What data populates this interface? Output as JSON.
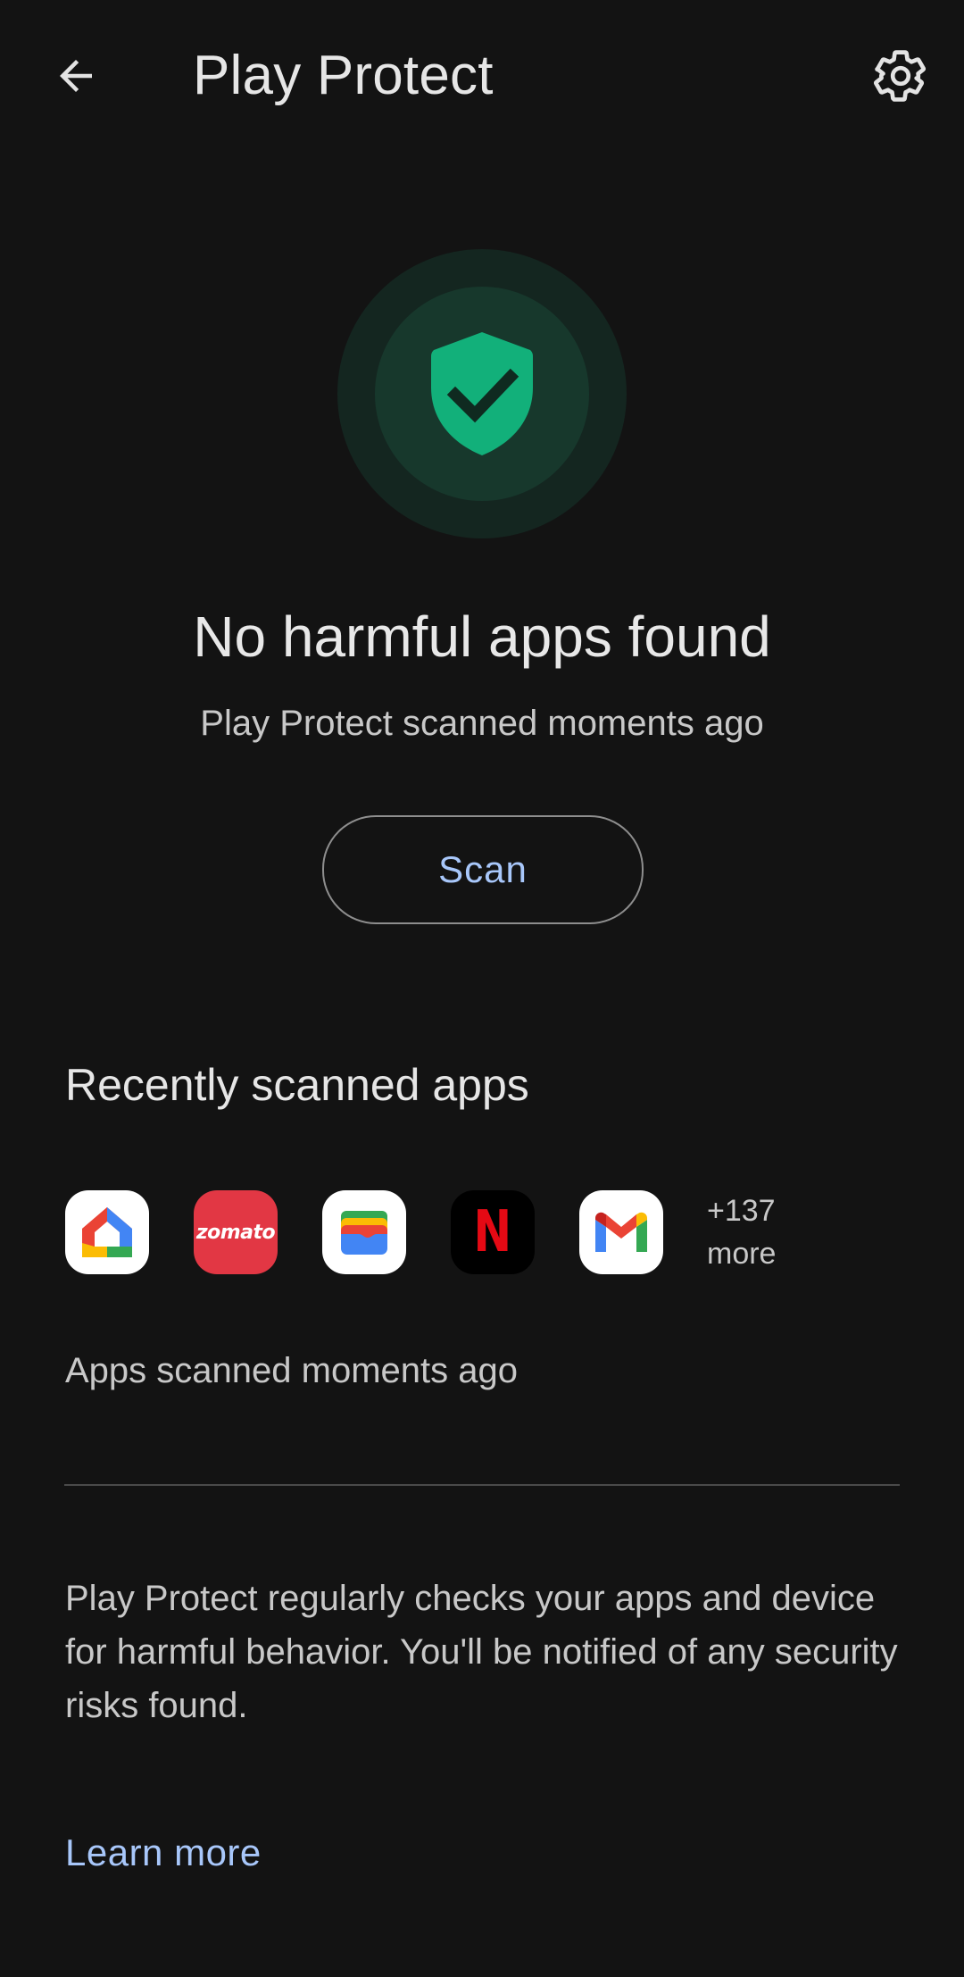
{
  "header": {
    "title": "Play Protect",
    "back_icon": "arrow-back-icon",
    "settings_icon": "gear-icon"
  },
  "status": {
    "icon": "shield-check-icon",
    "headline": "No harmful apps found",
    "subline": "Play Protect scanned moments ago",
    "scan_label": "Scan"
  },
  "recent": {
    "title": "Recently scanned apps",
    "apps": [
      {
        "name": "Google Home",
        "icon": "google-home-icon"
      },
      {
        "name": "zomato",
        "icon": "zomato-icon",
        "label": "zomato"
      },
      {
        "name": "Google Wallet",
        "icon": "google-wallet-icon"
      },
      {
        "name": "Netflix",
        "icon": "netflix-icon",
        "label": "N"
      },
      {
        "name": "Gmail",
        "icon": "gmail-icon"
      }
    ],
    "more_count": "+137",
    "more_label": "more",
    "scanned_text": "Apps scanned moments ago"
  },
  "info": {
    "text": "Play Protect regularly checks your apps and device for harmful behavior. You'll be notified of any security risks found.",
    "learn_more": "Learn more"
  },
  "colors": {
    "background": "#131313",
    "accent": "#a8c7fa",
    "shield_green": "#12b07a",
    "zomato_red": "#e23744",
    "netflix_red": "#e50914"
  }
}
